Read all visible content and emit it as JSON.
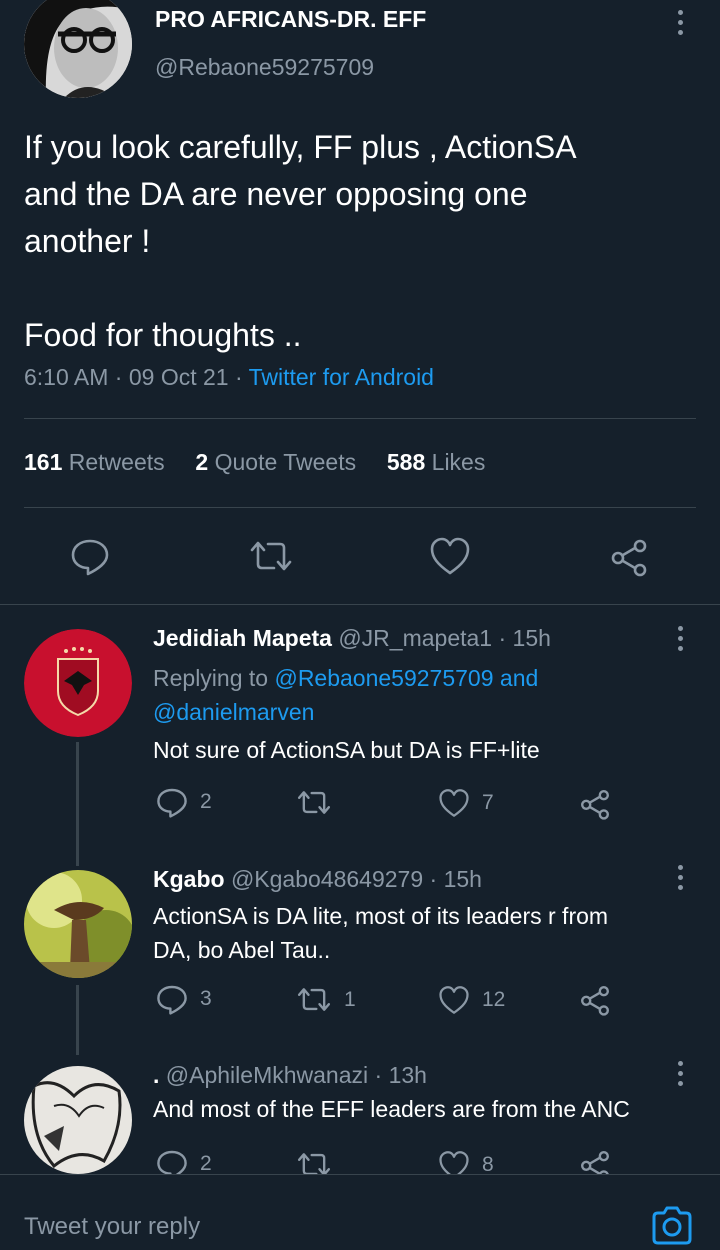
{
  "main_tweet": {
    "author_name": "PRO AFRICANS-DR. EFF",
    "author_handle": "@Rebaone59275709",
    "text_line1": "If you look carefully, FF plus , ActionSA",
    "text_line2": "and the DA are never opposing one",
    "text_line3": "another !",
    "text_line4": "Food for thoughts ..",
    "time": "6:10 AM",
    "date": "09 Oct 21",
    "source": "Twitter for Android",
    "retweets_count": "161",
    "retweets_label": "Retweets",
    "quotes_count": "2",
    "quotes_label": "Quote Tweets",
    "likes_count": "588",
    "likes_label": "Likes"
  },
  "replies": [
    {
      "name": "Jedidiah Mapeta",
      "handle": "@JR_mapeta1",
      "time": "15h",
      "replying_prefix": "Replying to",
      "replying_to_1": "@Rebaone59275709",
      "replying_and": "and",
      "replying_to_2": "@danielmarven",
      "text": "Not sure of ActionSA but DA is FF+lite",
      "reply_count": "2",
      "retweet_count": "",
      "like_count": "7"
    },
    {
      "name": "Kgabo",
      "handle": "@Kgabo48649279",
      "time": "15h",
      "text_line1": "ActionSA is DA lite, most of its leaders r from",
      "text_line2": "DA, bo Abel Tau..",
      "reply_count": "3",
      "retweet_count": "1",
      "like_count": "12"
    },
    {
      "name": ".",
      "handle": "@AphileMkhwanazi",
      "time": "13h",
      "text": "And most of the EFF leaders are from the ANC",
      "reply_count": "2",
      "retweet_count": "",
      "like_count": "8"
    }
  ],
  "composer": {
    "placeholder": "Tweet your reply"
  },
  "colors": {
    "background": "#15202b",
    "accent": "#1d9bf0",
    "muted": "#8b98a5",
    "divider": "#38444d"
  },
  "icons": [
    "more-options-icon",
    "reply-icon",
    "retweet-icon",
    "like-icon",
    "share-icon",
    "camera-icon"
  ]
}
